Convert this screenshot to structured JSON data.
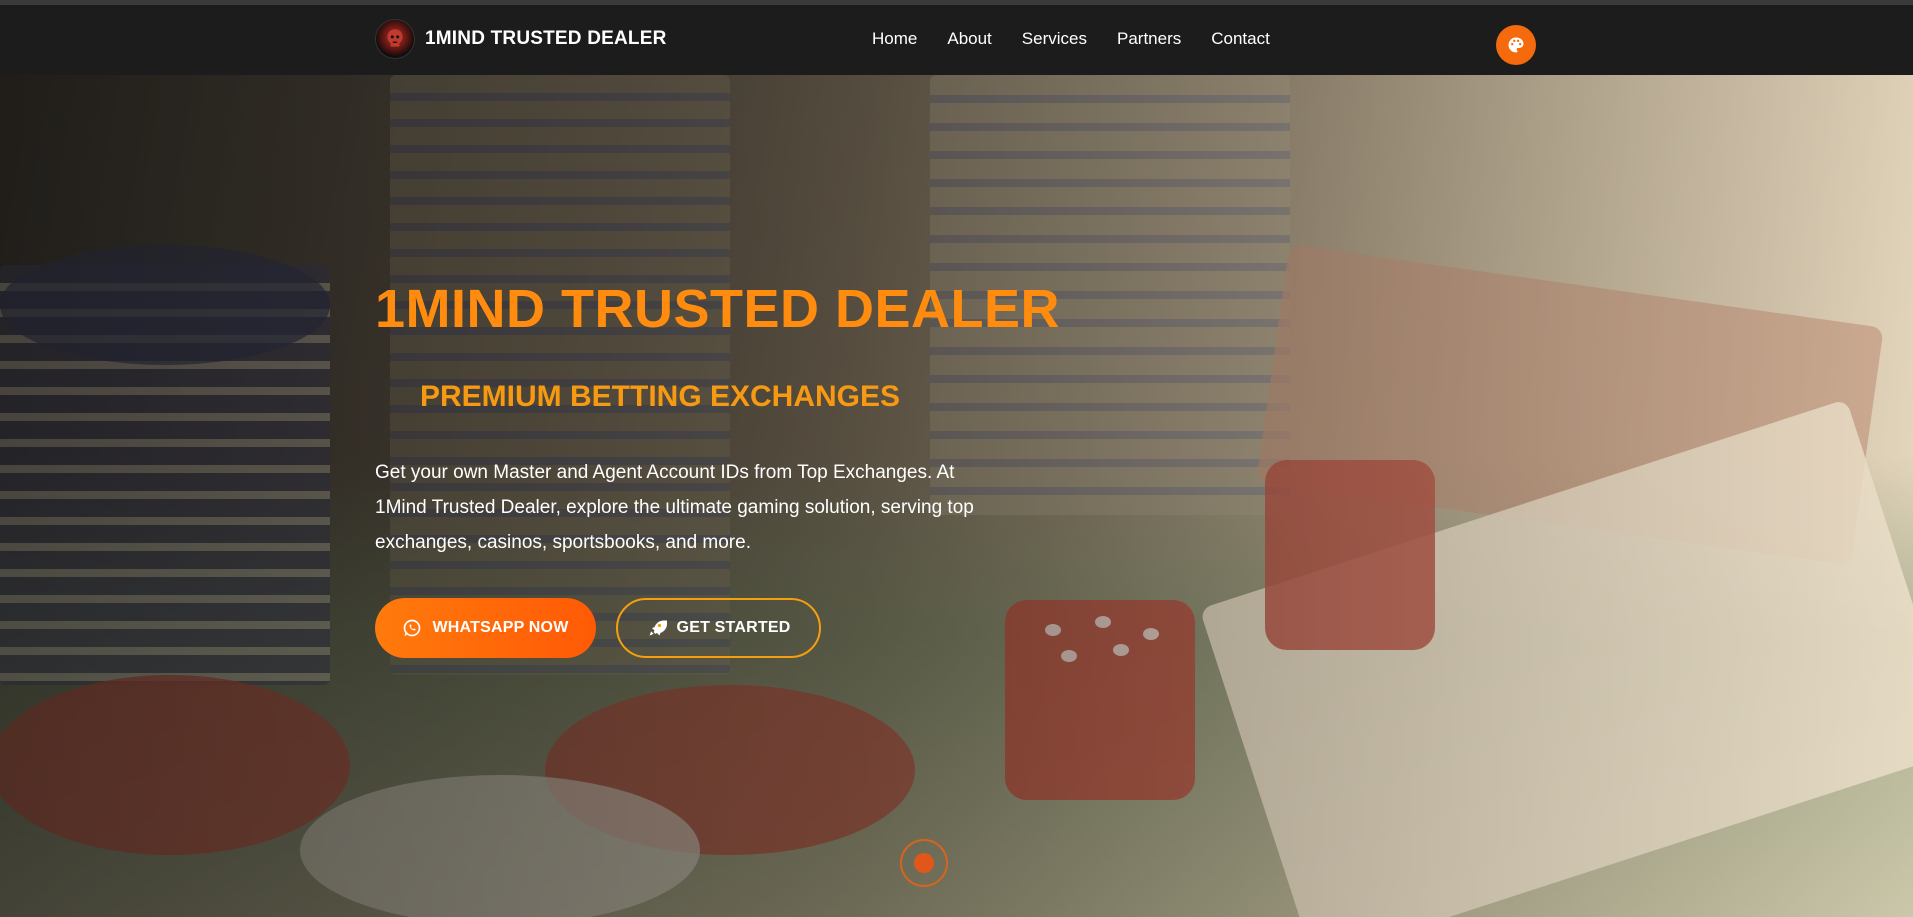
{
  "header": {
    "brand_name": "1MIND TRUSTED DEALER",
    "nav": [
      "Home",
      "About",
      "Services",
      "Partners",
      "Contact"
    ],
    "theme_icon": "palette-icon"
  },
  "hero": {
    "title": "1MIND TRUSTED DEALER",
    "subtitle": "PREMIUM BETTING EXCHANGES",
    "description": "Get your own Master and Agent Account IDs from Top Exchanges. At 1Mind Trusted Dealer, explore the ultimate gaming solution, serving top exchanges, casinos, sportsbooks, and more.",
    "buttons": {
      "whatsapp": {
        "label": "WHATSAPP NOW",
        "icon": "whatsapp-icon"
      },
      "start": {
        "label": "GET STARTED",
        "icon": "rocket-icon"
      }
    }
  },
  "colors": {
    "accent": "#ff7a0c",
    "title": "#ff8c0f",
    "subtitle": "#f59a12",
    "navbar": "#1c1c1c"
  }
}
